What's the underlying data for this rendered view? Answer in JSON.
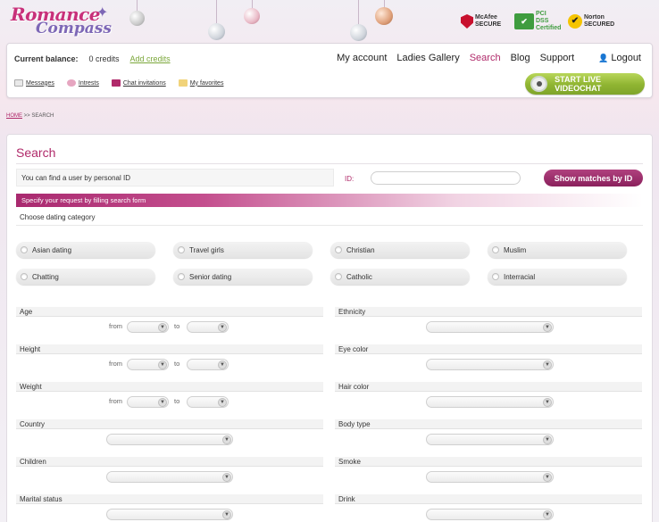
{
  "brand": {
    "line1": "Romance",
    "line2": "Compass"
  },
  "trust_badges": [
    {
      "name": "mcafee",
      "text": "McAfee SECURE"
    },
    {
      "name": "pci",
      "text": "PCI DSS Certified"
    },
    {
      "name": "norton",
      "text": "Norton SECURED"
    }
  ],
  "account": {
    "balance_label": "Current balance:",
    "credits": "0 credits",
    "add_credits": "Add credits"
  },
  "topnav": [
    "My account",
    "Ladies Gallery",
    "Search",
    "Blog",
    "Support"
  ],
  "logout": "Logout",
  "subnav": [
    "Messages",
    "Intrests",
    "Chat invitations",
    "My favorites"
  ],
  "videochat_label": "START LIVE VIDEOCHAT",
  "breadcrumb": {
    "home": "HOME",
    "sep": ">>",
    "current": "SEARCH"
  },
  "page_title": "Search",
  "id_search": {
    "text": "You can find a user by personal ID",
    "label": "ID:",
    "button": "Show matches by ID"
  },
  "hint": "Specify your request by filling search form",
  "category_title": "Choose dating category",
  "categories": [
    "Asian dating",
    "Travel girls",
    "Christian",
    "Muslim",
    "Chatting",
    "Senior dating",
    "Catholic",
    "Interracial"
  ],
  "range_words": {
    "from": "from",
    "to": "to"
  },
  "fields_left": [
    "Age",
    "Height",
    "Weight",
    "Country",
    "Children",
    "Marital status"
  ],
  "fields_right": [
    "Ethnicity",
    "Eye color",
    "Hair color",
    "Body type",
    "Smoke",
    "Drink"
  ],
  "colors": {
    "accent": "#b02a6a",
    "green": "#8fb431"
  }
}
